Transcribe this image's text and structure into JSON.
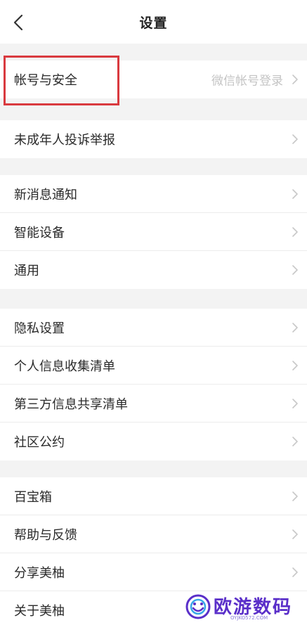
{
  "header": {
    "title": "设置",
    "back_icon": "chevron-left-icon"
  },
  "groups": [
    {
      "items": [
        {
          "label": "帐号与安全",
          "value": "微信帐号登录",
          "icon": "chevron-right-icon"
        }
      ]
    },
    {
      "items": [
        {
          "label": "未成年人投诉举报",
          "icon": "chevron-right-icon"
        }
      ]
    },
    {
      "items": [
        {
          "label": "新消息通知",
          "icon": "chevron-right-icon"
        },
        {
          "label": "智能设备",
          "icon": "chevron-right-icon"
        },
        {
          "label": "通用",
          "icon": "chevron-right-icon"
        }
      ]
    },
    {
      "items": [
        {
          "label": "隐私设置",
          "icon": "chevron-right-icon"
        },
        {
          "label": "个人信息收集清单",
          "icon": "chevron-right-icon"
        },
        {
          "label": "第三方信息共享清单",
          "icon": "chevron-right-icon"
        },
        {
          "label": "社区公约",
          "icon": "chevron-right-icon"
        }
      ]
    },
    {
      "items": [
        {
          "label": "百宝箱",
          "icon": "chevron-right-icon"
        },
        {
          "label": "帮助与反馈",
          "icon": "chevron-right-icon"
        },
        {
          "label": "分享美柚",
          "icon": "chevron-right-icon"
        },
        {
          "label": "关于美柚",
          "icon": "chevron-right-icon"
        }
      ]
    }
  ],
  "annotation": {
    "highlight_color": "#d93a3f"
  },
  "watermark": {
    "text": "欧游数码",
    "subtext": "OYJKO572.COM",
    "color": "#5a2fc9"
  }
}
